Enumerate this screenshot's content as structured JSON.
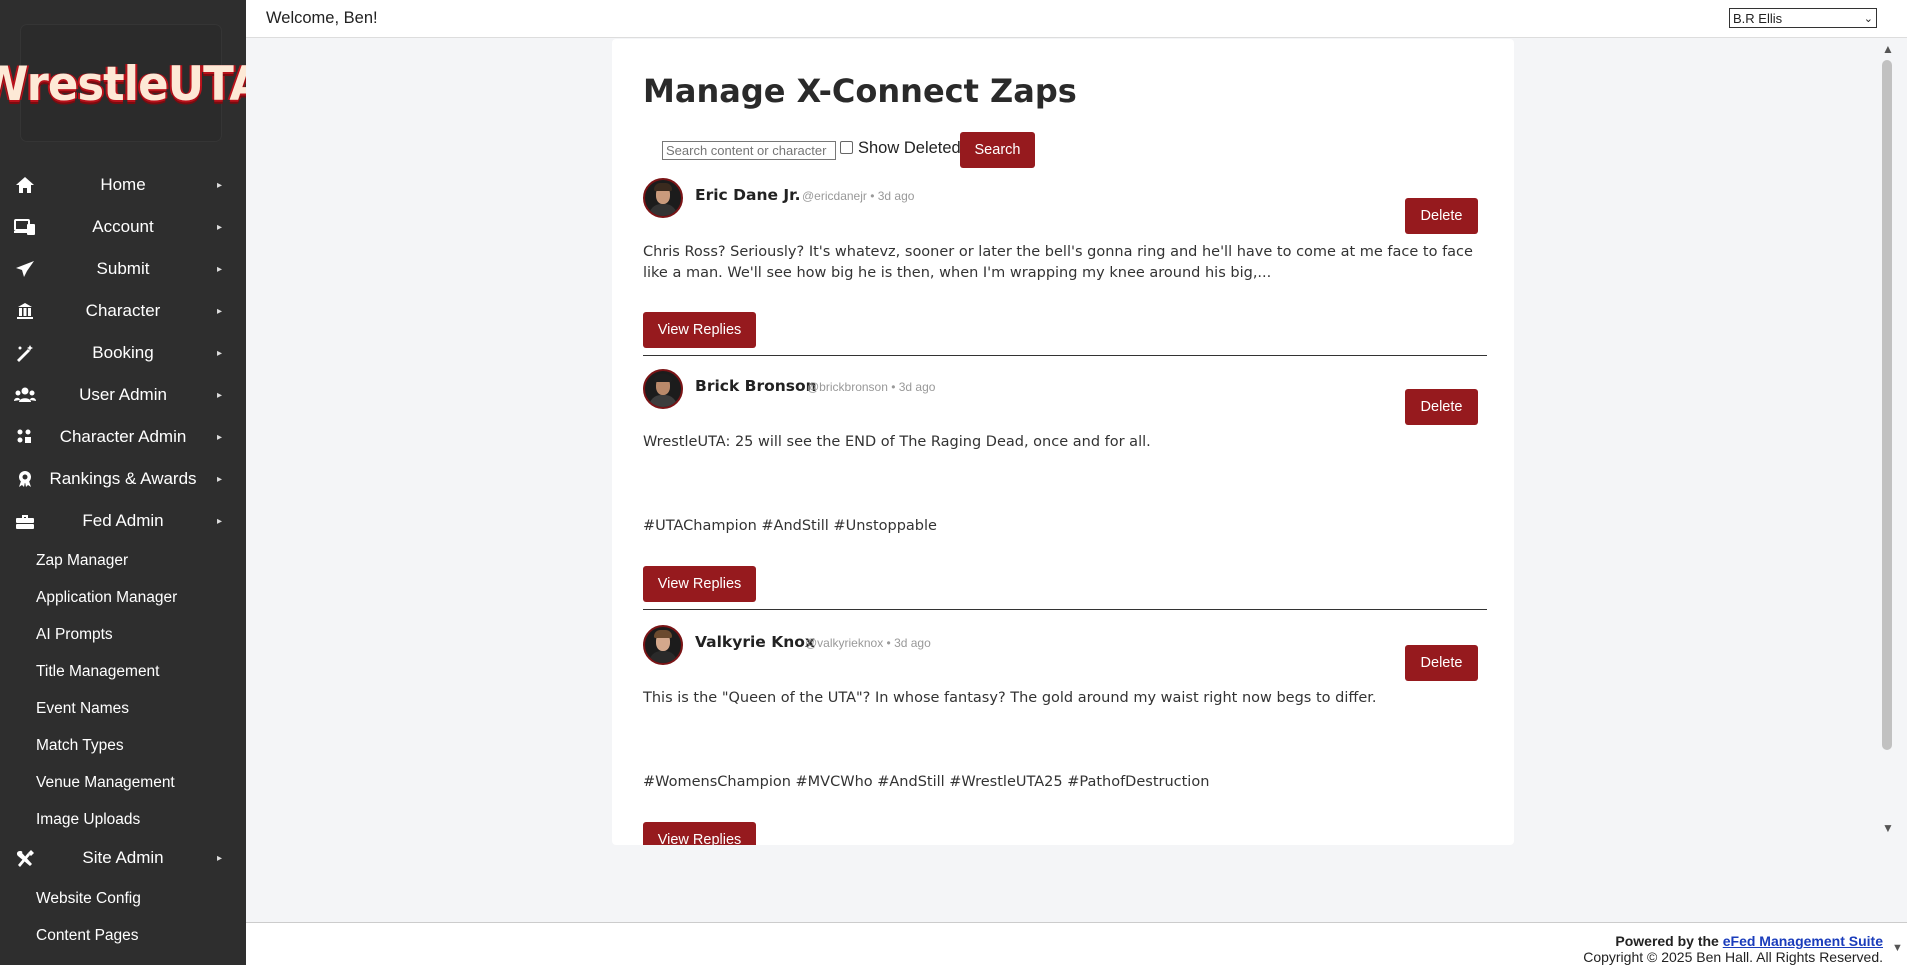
{
  "brand": {
    "logo_text": "WrestleUTA"
  },
  "topbar": {
    "welcome": "Welcome, Ben!",
    "user_select_value": "B.R Ellis"
  },
  "sidebar": {
    "nav": [
      {
        "label": "Home",
        "icon": "home-icon"
      },
      {
        "label": "Account",
        "icon": "devices-icon"
      },
      {
        "label": "Submit",
        "icon": "paper-plane-icon"
      },
      {
        "label": "Character",
        "icon": "building-icon"
      },
      {
        "label": "Booking",
        "icon": "magic-wand-icon"
      },
      {
        "label": "User Admin",
        "icon": "users-icon"
      },
      {
        "label": "Character Admin",
        "icon": "grid-dots-icon"
      },
      {
        "label": "Rankings & Awards",
        "icon": "award-icon"
      },
      {
        "label": "Fed Admin",
        "icon": "toolbox-icon"
      },
      {
        "label": "Site Admin",
        "icon": "tools-icon"
      }
    ],
    "fed_admin_items": [
      "Zap Manager",
      "Application Manager",
      "AI Prompts",
      "Title Management",
      "Event Names",
      "Match Types",
      "Venue Management",
      "Image Uploads"
    ],
    "site_admin_items": [
      "Website Config",
      "Content Pages"
    ],
    "arrow": "▸"
  },
  "main": {
    "title": "Manage X-Connect Zaps",
    "search_placeholder": "Search content or character",
    "show_deleted_label": "Show Deleted",
    "search_button": "Search",
    "delete_label": "Delete",
    "view_replies_label": "View Replies",
    "posts": [
      {
        "author": "Eric Dane Jr.",
        "meta": "@ericdanejr • 3d ago",
        "lines": [
          "Chris Ross? Seriously? It's whatevz, sooner or later the bell's gonna ring and he'll have to come at me face to face like a man. We'll see how big he is then, when I'm wrapping my knee around his big,..."
        ]
      },
      {
        "author": "Brick Bronson",
        "meta": "@brickbronson • 3d ago",
        "lines": [
          "WrestleUTA: 25 will see the END of The Raging Dead, once and for all.",
          "#UTAChampion #AndStill #Unstoppable"
        ]
      },
      {
        "author": "Valkyrie Knox",
        "meta": "@valkyrieknox • 3d ago",
        "lines": [
          "This is the \"Queen of the UTA\"? In whose fantasy? The gold around my waist right now begs to differ.",
          "#WomensChampion #MVCWho #AndStill #WrestleUTA25 #PathofDestruction"
        ]
      }
    ]
  },
  "footer": {
    "powered_prefix": "Powered by the ",
    "powered_link": "eFed Management Suite",
    "copyright": "Copyright © 2025 Ben Hall. All Rights Reserved."
  }
}
